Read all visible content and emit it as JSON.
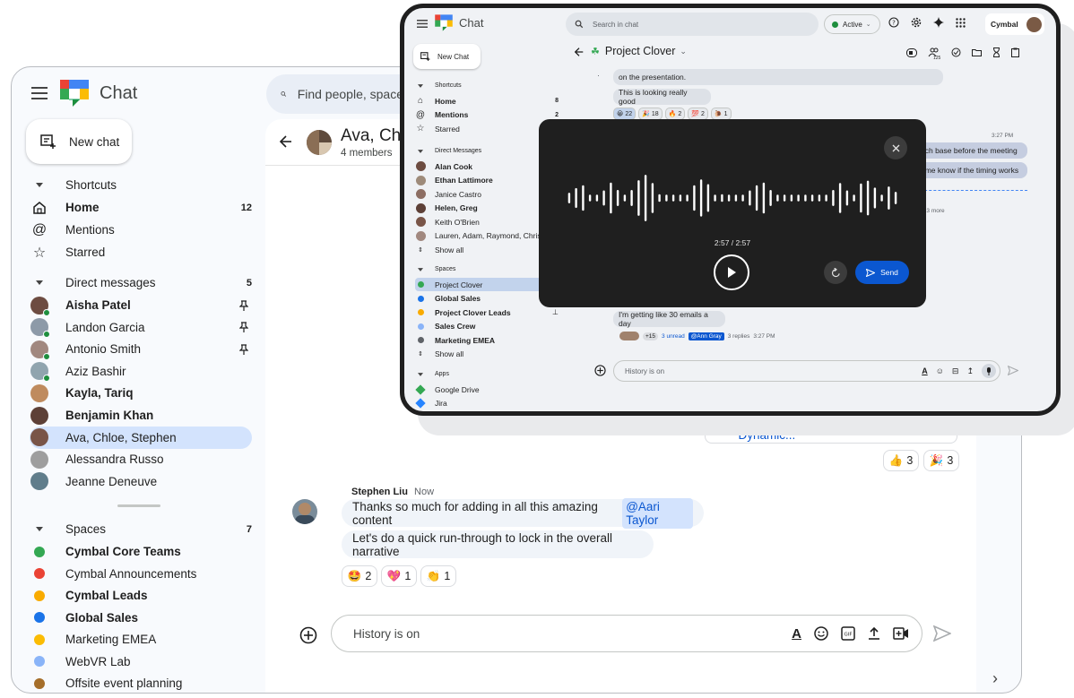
{
  "bg": {
    "app_title": "Chat",
    "search_placeholder": "Find people, spaces",
    "new_chat": "New chat",
    "sections": {
      "shortcuts": "Shortcuts",
      "direct_messages": "Direct messages",
      "direct_messages_count": "5",
      "spaces": "Spaces",
      "spaces_count": "7"
    },
    "shortcuts": [
      {
        "label": "Home",
        "count": "12"
      },
      {
        "label": "Mentions"
      },
      {
        "label": "Starred"
      }
    ],
    "dms": [
      {
        "name": "Aisha Patel",
        "bold": true,
        "pinned": true
      },
      {
        "name": "Landon Garcia",
        "pinned": true
      },
      {
        "name": "Antonio Smith",
        "pinned": true
      },
      {
        "name": "Aziz Bashir"
      },
      {
        "name": "Kayla, Tariq",
        "bold": true
      },
      {
        "name": "Benjamin Khan",
        "bold": true
      },
      {
        "name": "Ava, Chloe, Stephen",
        "selected": true
      },
      {
        "name": "Alessandra Russo"
      },
      {
        "name": "Jeanne Deneuve"
      }
    ],
    "spaces": [
      {
        "name": "Cymbal Core Teams",
        "bold": true
      },
      {
        "name": "Cymbal Announcements"
      },
      {
        "name": "Cymbal Leads",
        "bold": true
      },
      {
        "name": "Global Sales",
        "bold": true
      },
      {
        "name": "Marketing EMEA"
      },
      {
        "name": "WebVR Lab"
      },
      {
        "name": "Offsite event planning"
      }
    ],
    "conversation": {
      "title": "Ava, Ch",
      "members": "4 members",
      "attachment": "Research Study for Dynamic...",
      "reactions_top": [
        {
          "emoji": "👍",
          "count": "3"
        },
        {
          "emoji": "🎉",
          "count": "3"
        }
      ],
      "message": {
        "author": "Stephen Liu",
        "time": "Now",
        "line1": "Thanks so much for adding in all this amazing content",
        "mention": "@Aari Taylor",
        "line2": "Let's do a quick run-through to lock in the overall narrative"
      },
      "reactions": [
        {
          "emoji": "🤩",
          "count": "2"
        },
        {
          "emoji": "💖",
          "count": "1"
        },
        {
          "emoji": "👏",
          "count": "1"
        }
      ],
      "composer_placeholder": "History is on"
    }
  },
  "fg": {
    "app_title": "Chat",
    "search_placeholder": "Search in chat",
    "status": "Active",
    "brand": "Cymbal",
    "new_chat": "New Chat",
    "sections": {
      "shortcuts": "Shortcuts",
      "direct_messages": "Direct Messages",
      "spaces": "Spaces",
      "apps": "Apps"
    },
    "shortcuts": [
      {
        "label": "Home",
        "count": "8"
      },
      {
        "label": "Mentions",
        "count": "2"
      },
      {
        "label": "Starred"
      }
    ],
    "dms": [
      {
        "name": "Alan Cook",
        "bold": true
      },
      {
        "name": "Ethan Lattimore",
        "bold": true
      },
      {
        "name": "Janice Castro"
      },
      {
        "name": "Helen, Greg",
        "bold": true
      },
      {
        "name": "Keith O'Brien"
      },
      {
        "name": "Lauren, Adam, Raymond, Chris"
      },
      {
        "name": "Show all"
      }
    ],
    "spaces": [
      {
        "name": "Project Clover",
        "selected": true
      },
      {
        "name": "Global Sales",
        "bold": true
      },
      {
        "name": "Project Clover Leads",
        "bold": true
      },
      {
        "name": "Sales Crew",
        "bold": true
      },
      {
        "name": "Marketing EMEA",
        "bold": true
      },
      {
        "name": "Show all"
      }
    ],
    "apps": [
      {
        "name": "Google Drive"
      },
      {
        "name": "Jira"
      }
    ],
    "conversation": {
      "title": "Project Clover",
      "msg1": "on the presentation.",
      "msg2": "This is looking really good",
      "reactions": [
        {
          "emoji": "😀",
          "count": "22"
        },
        {
          "emoji": "🎉",
          "count": "18"
        },
        {
          "emoji": "🔥",
          "count": "2"
        },
        {
          "emoji": "💯",
          "count": "2"
        },
        {
          "emoji": "🐌",
          "count": "1"
        }
      ],
      "time_right": "3:27 PM",
      "right1": "uch base before the meeting",
      "right2": "t me know if the timing works",
      "more": "+13 more",
      "msg3": "I'm getting like 30 emails a day",
      "thread_count": "+15",
      "unread": "3 unread",
      "mention": "@Ann Gray",
      "replies": "3 replies",
      "reply_time": "3:27 PM",
      "composer_placeholder": "History is on",
      "badge": "125"
    },
    "voice": {
      "time": "2:57 / 2:57",
      "send": "Send",
      "waveform": [
        0.18,
        0.38,
        0.5,
        0.1,
        0.1,
        0.28,
        0.62,
        0.3,
        0.1,
        0.3,
        0.72,
        0.95,
        0.6,
        0.12,
        0.1,
        0.1,
        0.1,
        0.1,
        0.5,
        0.75,
        0.55,
        0.1,
        0.12,
        0.1,
        0.1,
        0.1,
        0.28,
        0.5,
        0.62,
        0.3,
        0.1,
        0.1,
        0.1,
        0.1,
        0.1,
        0.1,
        0.1,
        0.1,
        0.3,
        0.6,
        0.28,
        0.1,
        0.58,
        0.7,
        0.4,
        0.1,
        0.45,
        0.22
      ]
    }
  }
}
